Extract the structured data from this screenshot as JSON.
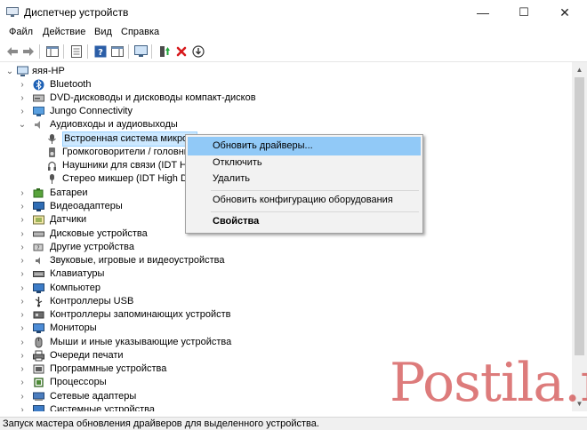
{
  "window": {
    "title": "Диспетчер устройств",
    "controls": {
      "minimize": "—",
      "maximize": "☐",
      "close": "✕"
    }
  },
  "menu": [
    "Файл",
    "Действие",
    "Вид",
    "Справка"
  ],
  "tree": {
    "root": "яяя-HP",
    "nodes": [
      {
        "label": "Bluetooth",
        "icon": "bluetooth-icon"
      },
      {
        "label": "DVD-дисководы и дисководы компакт-дисков",
        "icon": "dvd-drive-icon"
      },
      {
        "label": "Jungo Connectivity",
        "icon": "jungo-icon"
      },
      {
        "label": "Аудиовходы и аудиовыходы",
        "icon": "audio-io-icon",
        "children": [
          {
            "label": "Встроенная система микроф",
            "icon": "microphone-icon"
          },
          {
            "label": "Громкоговорители / головны",
            "icon": "speaker-icon"
          },
          {
            "label": "Наушники для связи (IDT High",
            "icon": "headset-icon"
          },
          {
            "label": "Стерео микшер (IDT High Def",
            "icon": "stereo-mixer-icon"
          }
        ]
      },
      {
        "label": "Батареи",
        "icon": "battery-icon"
      },
      {
        "label": "Видеоадаптеры",
        "icon": "display-adapter-icon"
      },
      {
        "label": "Датчики",
        "icon": "sensor-icon"
      },
      {
        "label": "Дисковые устройства",
        "icon": "disk-drive-icon"
      },
      {
        "label": "Другие устройства",
        "icon": "other-devices-icon"
      },
      {
        "label": "Звуковые, игровые и видеоустройства",
        "icon": "sound-icon"
      },
      {
        "label": "Клавиатуры",
        "icon": "keyboard-icon"
      },
      {
        "label": "Компьютер",
        "icon": "computer-icon"
      },
      {
        "label": "Контроллеры USB",
        "icon": "usb-icon"
      },
      {
        "label": "Контроллеры запоминающих устройств",
        "icon": "storage-controller-icon"
      },
      {
        "label": "Мониторы",
        "icon": "monitor-icon"
      },
      {
        "label": "Мыши и иные указывающие устройства",
        "icon": "mouse-icon"
      },
      {
        "label": "Очереди печати",
        "icon": "printer-icon"
      },
      {
        "label": "Программные устройства",
        "icon": "software-device-icon"
      },
      {
        "label": "Процессоры",
        "icon": "processor-icon"
      },
      {
        "label": "Сетевые адаптеры",
        "icon": "network-adapter-icon"
      },
      {
        "label": "Системные устройства",
        "icon": "system-device-icon"
      }
    ]
  },
  "context_menu": {
    "update": "Обновить драйверы...",
    "disable": "Отключить",
    "uninstall": "Удалить",
    "scan": "Обновить конфигурацию оборудования",
    "properties": "Свойства"
  },
  "status": "Запуск мастера обновления драйверов для выделенного устройства.",
  "watermark": "Postila.ru",
  "colors": {
    "selection": "#cce8ff",
    "menu_highlight": "#91c9f7",
    "watermark": "#cd3c3c"
  }
}
